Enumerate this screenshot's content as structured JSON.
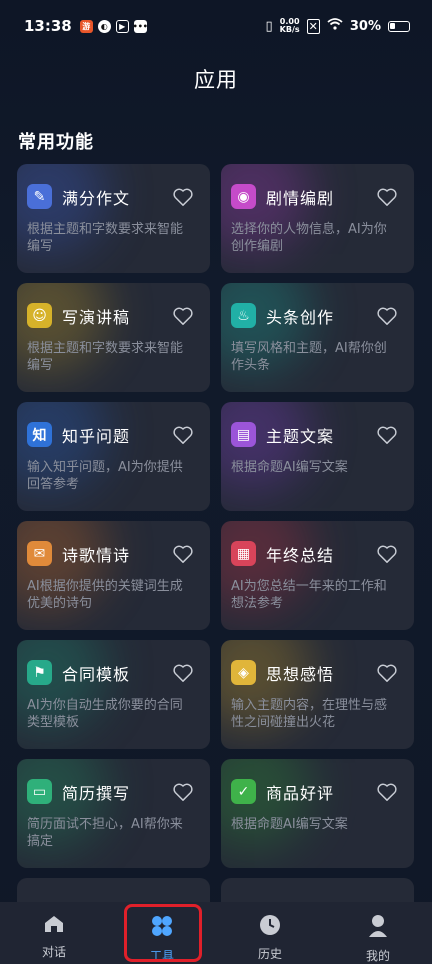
{
  "status_bar": {
    "time": "13:38",
    "net_speed_top": "0.00",
    "net_speed_bottom": "KB/s",
    "battery": "30%"
  },
  "page_title": "应用",
  "section_title": "常用功能",
  "cards": [
    {
      "title": "满分作文",
      "desc": "根据主题和字数要求来智能编写",
      "icon": "pencil-doc-icon",
      "icon_color": "#4a6fd8",
      "glow": "#3b5cc4"
    },
    {
      "title": "剧情编剧",
      "desc": "选择你的人物信息，AI为你创作编剧",
      "icon": "gamepad-icon",
      "icon_color": "#c54bc9",
      "glow": "#9a3bb0"
    },
    {
      "title": "写演讲稿",
      "desc": "根据主题和字数要求来智能编写",
      "icon": "speaker-person-icon",
      "icon_color": "#d6b22a",
      "glow": "#b8962a"
    },
    {
      "title": "头条创作",
      "desc": "填写风格和主题，AI帮你创作头条",
      "icon": "flame-icon",
      "icon_color": "#21b0a6",
      "glow": "#1b9a8f"
    },
    {
      "title": "知乎问题",
      "desc": "输入知乎问题，AI为你提供回答参考",
      "icon": "zhihu-icon",
      "icon_color": "#2f72d8",
      "glow": "#2a5fba"
    },
    {
      "title": "主题文案",
      "desc": "根据命题AI编写文案",
      "icon": "printer-icon",
      "icon_color": "#9b55d9",
      "glow": "#7d3fc0"
    },
    {
      "title": "诗歌情诗",
      "desc": "AI根据你提供的关键词生成优美的诗句",
      "icon": "envelope-heart-icon",
      "icon_color": "#e08a3a",
      "glow": "#c06a2a"
    },
    {
      "title": "年终总结",
      "desc": "AI为您总结一年来的工作和想法参考",
      "icon": "report-icon",
      "icon_color": "#d8445a",
      "glow": "#b33346"
    },
    {
      "title": "合同模板",
      "desc": "AI为你自动生成你要的合同类型模板",
      "icon": "stamp-icon",
      "icon_color": "#27a98a",
      "glow": "#1f8d73"
    },
    {
      "title": "思想感悟",
      "desc": "输入主题内容，在理性与感性之间碰撞出火花",
      "icon": "chat-bulb-icon",
      "icon_color": "#e0b53a",
      "glow": "#b8922a"
    },
    {
      "title": "简历撰写",
      "desc": "简历面试不担心，AI帮你来搞定",
      "icon": "id-card-icon",
      "icon_color": "#2fb07a",
      "glow": "#258f62"
    },
    {
      "title": "商品好评",
      "desc": "根据命题AI编写文案",
      "icon": "thumbs-up-icon",
      "icon_color": "#3fb24a",
      "glow": "#2f8f38"
    }
  ],
  "nav": [
    {
      "label": "对话",
      "icon": "home-icon"
    },
    {
      "label": "工具",
      "icon": "clover-icon"
    },
    {
      "label": "历史",
      "icon": "clock-icon"
    },
    {
      "label": "我的",
      "icon": "user-icon"
    }
  ]
}
